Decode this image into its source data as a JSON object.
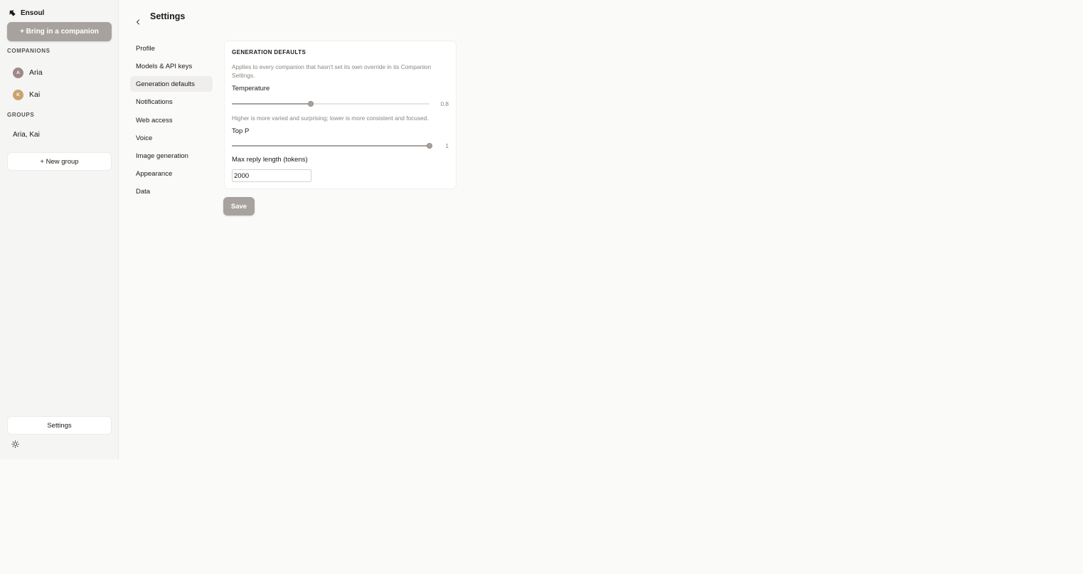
{
  "sidebar": {
    "brand": "Ensoul",
    "bring_button": "+ Bring in a companion",
    "companions_label": "COMPANIONS",
    "companions": [
      {
        "initial": "A",
        "name": "Aria",
        "color": "#a08886"
      },
      {
        "initial": "K",
        "name": "Kai",
        "color": "#c9a46c"
      }
    ],
    "groups_label": "GROUPS",
    "groups": [
      "Aria, Kai"
    ],
    "new_group_button": "+ New group",
    "settings_button": "Settings",
    "theme_icon": "sun-icon"
  },
  "header": {
    "title": "Settings",
    "back_icon": "chevron-left-icon"
  },
  "nav": {
    "items": [
      "Profile",
      "Models & API keys",
      "Generation defaults",
      "Notifications",
      "Web access",
      "Voice",
      "Image generation",
      "Appearance",
      "Data"
    ],
    "active": "Generation defaults"
  },
  "card": {
    "title": "GENERATION DEFAULTS",
    "description": "Applies to every companion that hasn't set its own override in its Companion Settings.",
    "temperature": {
      "label": "Temperature",
      "value": 0.8,
      "value_text": "0.8",
      "min": 0,
      "max": 2,
      "hint": "Higher is more varied and surprising; lower is more consistent and focused."
    },
    "top_p": {
      "label": "Top P",
      "value": 1,
      "value_text": "1",
      "min": 0,
      "max": 1
    },
    "max_tokens": {
      "label": "Max reply length (tokens)",
      "value": "2000"
    }
  },
  "save_button": "Save",
  "colors": {
    "accent": "#a8a29e",
    "background": "#fafaf9",
    "sidebar": "#f5f5f4"
  }
}
